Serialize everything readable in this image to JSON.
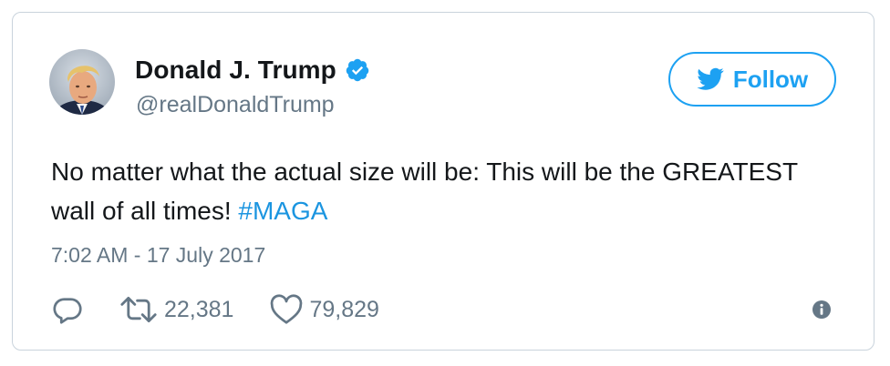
{
  "user": {
    "display_name": "Donald J. Trump",
    "handle": "@realDonaldTrump",
    "verified": true
  },
  "follow_button": {
    "label": "Follow",
    "icon": "twitter-bird-icon"
  },
  "tweet": {
    "text": "No matter what the actual size will be: This will be the GREATEST wall of all times! ",
    "hashtag": "#MAGA",
    "timestamp": "7:02 AM - 17 July 2017"
  },
  "actions": {
    "reply_icon": "reply-icon",
    "retweet_icon": "retweet-icon",
    "retweet_count": "22,381",
    "like_icon": "heart-icon",
    "like_count": "79,829",
    "info_icon": "info-icon"
  },
  "colors": {
    "accent": "#1da1f2",
    "hashtag": "#1b95e0",
    "text_primary": "#14171a",
    "text_secondary": "#657786",
    "border": "#c9d3dc"
  }
}
